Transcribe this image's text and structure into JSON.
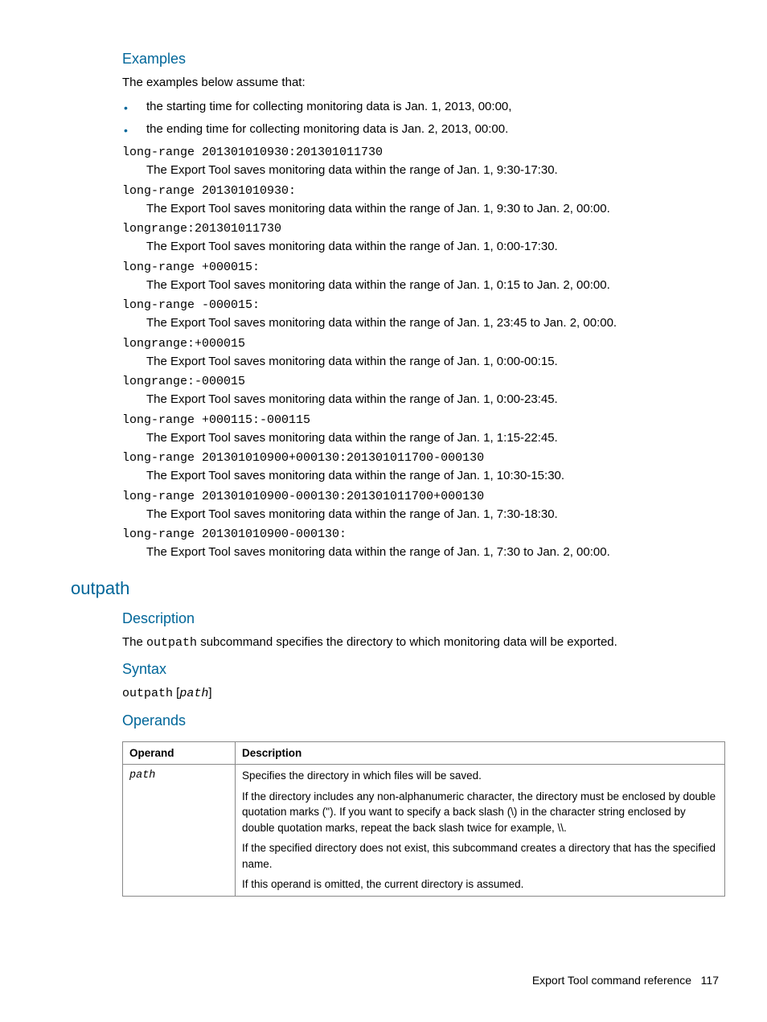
{
  "examples": {
    "heading": "Examples",
    "intro": "The examples below assume that:",
    "bullets": [
      "the starting time for collecting monitoring data is Jan. 1, 2013, 00:00,",
      "the ending time for collecting monitoring data is Jan. 2, 2013, 00:00."
    ],
    "items": [
      {
        "cmd": "long-range 201301010930:201301011730",
        "desc": "The Export Tool saves monitoring data within the range of Jan. 1, 9:30-17:30."
      },
      {
        "cmd": "long-range 201301010930:",
        "desc": "The Export Tool saves monitoring data within the range of Jan. 1, 9:30 to Jan. 2, 00:00."
      },
      {
        "cmd": "longrange:201301011730",
        "desc": "The Export Tool saves monitoring data within the range of Jan. 1, 0:00-17:30."
      },
      {
        "cmd": "long-range +000015:",
        "desc": "The Export Tool saves monitoring data within the range of Jan. 1, 0:15 to Jan. 2, 00:00."
      },
      {
        "cmd": "long-range -000015:",
        "desc": "The Export Tool saves monitoring data within the range of Jan. 1, 23:45 to Jan. 2, 00:00."
      },
      {
        "cmd": "longrange:+000015",
        "desc": "The Export Tool saves monitoring data within the range of Jan. 1, 0:00-00:15."
      },
      {
        "cmd": "longrange:-000015",
        "desc": "The Export Tool saves monitoring data within the range of Jan. 1, 0:00-23:45."
      },
      {
        "cmd": "long-range +000115:-000115",
        "desc": "The Export Tool saves monitoring data within the range of Jan. 1, 1:15-22:45."
      },
      {
        "cmd": "long-range 201301010900+000130:201301011700-000130",
        "desc": "The Export Tool saves monitoring data within the range of Jan. 1, 10:30-15:30."
      },
      {
        "cmd": "long-range 201301010900-000130:201301011700+000130",
        "desc": "The Export Tool saves monitoring data within the range of Jan. 1, 7:30-18:30."
      },
      {
        "cmd": "long-range 201301010900-000130:",
        "desc": "The Export Tool saves monitoring data within the range of Jan. 1, 7:30 to Jan. 2, 00:00."
      }
    ]
  },
  "outpath": {
    "heading": "outpath",
    "description": {
      "heading": "Description",
      "text_pre": "The ",
      "code": "outpath",
      "text_post": " subcommand specifies the directory to which monitoring data will be exported."
    },
    "syntax": {
      "heading": "Syntax",
      "cmd": "outpath",
      "space": " [",
      "arg": "path",
      "close": "]"
    },
    "operands": {
      "heading": "Operands",
      "headers": {
        "operand": "Operand",
        "description": "Description"
      },
      "row": {
        "operand": "path",
        "paras": [
          "Specifies the directory in which files will be saved.",
          "If the directory includes any non-alphanumeric character, the directory must be enclosed by double quotation marks (\"). If you want to specify a back slash (\\) in the character string enclosed by double quotation marks, repeat the back slash twice for example, \\\\.",
          "If the specified directory does not exist, this subcommand creates a directory that has the specified name.",
          "If this operand is omitted, the current directory is assumed."
        ]
      }
    }
  },
  "footer": {
    "text": "Export Tool command reference",
    "page": "117"
  }
}
